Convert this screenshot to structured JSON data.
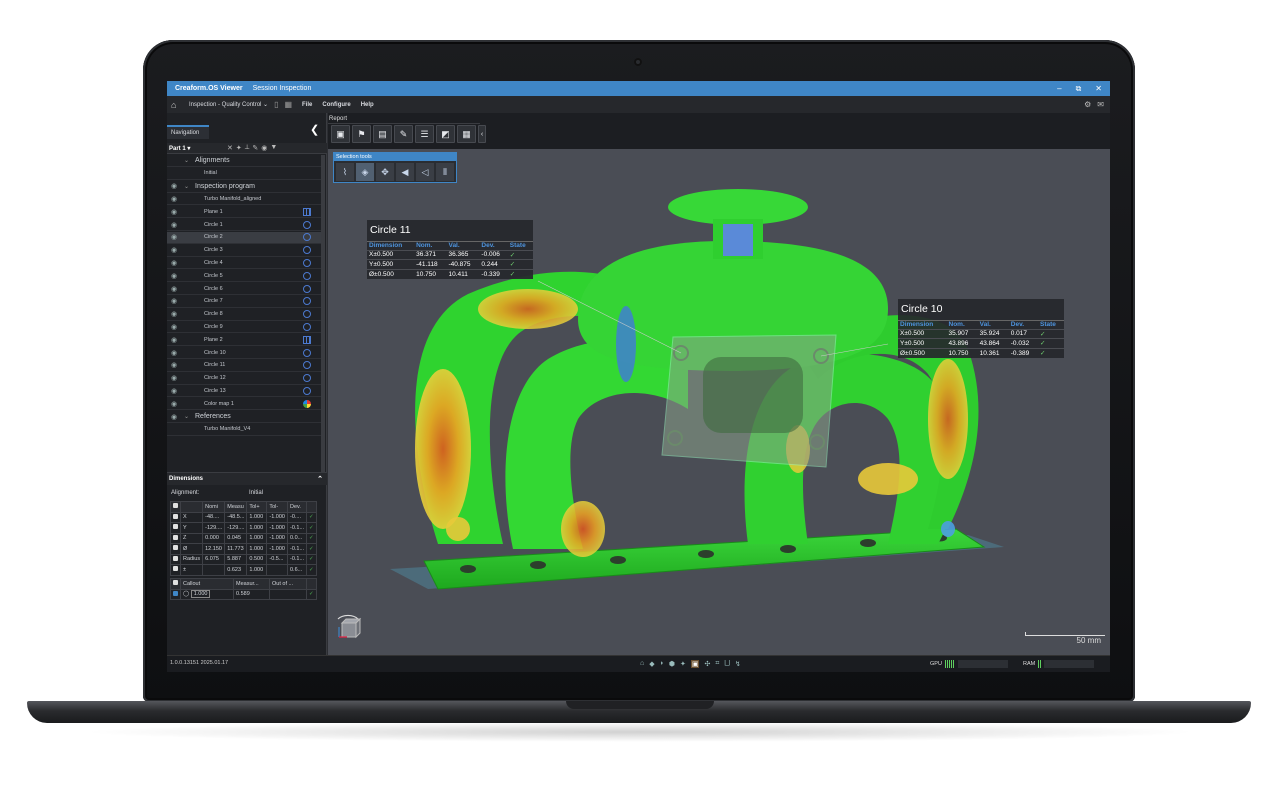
{
  "window": {
    "app_title": "Creaform.OS  Viewer",
    "session_title": "Session Inspection",
    "minimize": "–",
    "maximize": "⧉",
    "close": "✕"
  },
  "menubar": {
    "mode": "Inspection - Quality Control ⌄",
    "items": [
      "File",
      "Configure",
      "Help"
    ]
  },
  "navigation": {
    "tab_label": "Navigation",
    "part_selector": "Part 1",
    "collapse_glyph": "❮",
    "tree": [
      {
        "label": "Alignments",
        "type": "section",
        "eye": false,
        "expanded": true
      },
      {
        "label": "Initial",
        "type": "item",
        "eye": false
      },
      {
        "label": "Inspection program",
        "type": "section",
        "eye": true,
        "expanded": true
      },
      {
        "label": "Turbo Manifold_aligned",
        "type": "item",
        "eye": true
      },
      {
        "label": "Plane 1",
        "type": "item",
        "eye": true,
        "icon": "plane"
      },
      {
        "label": "Circle 1",
        "type": "item",
        "eye": true,
        "icon": "circle"
      },
      {
        "label": "Circle 2",
        "type": "item",
        "eye": true,
        "icon": "circle",
        "selected": true
      },
      {
        "label": "Circle 3",
        "type": "item",
        "eye": true,
        "icon": "circle"
      },
      {
        "label": "Circle 4",
        "type": "item",
        "eye": true,
        "icon": "circle"
      },
      {
        "label": "Circle 5",
        "type": "item",
        "eye": true,
        "icon": "circle"
      },
      {
        "label": "Circle 6",
        "type": "item",
        "eye": true,
        "icon": "circle"
      },
      {
        "label": "Circle 7",
        "type": "item",
        "eye": true,
        "icon": "circle"
      },
      {
        "label": "Circle 8",
        "type": "item",
        "eye": true,
        "icon": "circle"
      },
      {
        "label": "Circle 9",
        "type": "item",
        "eye": true,
        "icon": "circle"
      },
      {
        "label": "Plane 2",
        "type": "item",
        "eye": true,
        "icon": "plane"
      },
      {
        "label": "Circle 10",
        "type": "item",
        "eye": true,
        "icon": "circle"
      },
      {
        "label": "Circle 11",
        "type": "item",
        "eye": true,
        "icon": "circle"
      },
      {
        "label": "Circle 12",
        "type": "item",
        "eye": true,
        "icon": "circle"
      },
      {
        "label": "Circle 13",
        "type": "item",
        "eye": true,
        "icon": "circle"
      },
      {
        "label": "Color map 1",
        "type": "item",
        "eye": true,
        "icon": "colormap"
      },
      {
        "label": "References",
        "type": "section",
        "eye": true,
        "expanded": true
      },
      {
        "label": "Turbo Manifold_V4",
        "type": "item",
        "eye": false
      }
    ]
  },
  "dimensions": {
    "title": "Dimensions",
    "alignment_label": "Alignment:",
    "alignment_value": "Initial",
    "columns": [
      "",
      "",
      "Nomi",
      "Measu",
      "Tol+",
      "Tol-",
      "Dev.",
      ""
    ],
    "rows": [
      {
        "axis": "X",
        "nom": "-48....",
        "meas": "-48.5...",
        "tolp": "1.000",
        "tolm": "-1.000",
        "dev": "-0....",
        "ok": "✓"
      },
      {
        "axis": "Y",
        "nom": "-129....",
        "meas": "-129....",
        "tolp": "1.000",
        "tolm": "-1.000",
        "dev": "-0.1...",
        "ok": "✓"
      },
      {
        "axis": "Z",
        "nom": "0.000",
        "meas": "0.045",
        "tolp": "1.000",
        "tolm": "-1.000",
        "dev": "0.0...",
        "ok": "✓"
      },
      {
        "axis": "Ø",
        "nom": "12.150",
        "meas": "11.773",
        "tolp": "1.000",
        "tolm": "-1.000",
        "dev": "-0.1...",
        "ok": "✓"
      },
      {
        "axis": "Radius",
        "nom": "6.075",
        "meas": "5.887",
        "tolp": "0.500",
        "tolm": "-0.5...",
        "dev": "-0.1...",
        "ok": "✓"
      },
      {
        "axis": "±",
        "nom": "",
        "meas": "0.623",
        "tolp": "1.000",
        "tolm": "",
        "dev": "0.6...",
        "ok": "✓"
      }
    ],
    "callout_columns": [
      "Callout",
      "Measur...",
      "Out of ..."
    ],
    "callout_row": {
      "tol": "1.000",
      "meas": "0.589",
      "ok": "✓"
    }
  },
  "report": {
    "label": "Report",
    "tools": [
      "report-snapshot",
      "report-flag",
      "report-capture",
      "report-edit",
      "report-page",
      "report-chart",
      "report-table"
    ]
  },
  "selection_tools": {
    "label": "Selection tools",
    "tools": [
      "lasso",
      "surface",
      "freeform",
      "select-a",
      "select-b",
      "mirror"
    ]
  },
  "callouts": [
    {
      "title": "Circle 11",
      "headers": [
        "Dimension",
        "Nom.",
        "Val.",
        "Dev.",
        "State"
      ],
      "rows": [
        [
          "X±0.500",
          "36.371",
          "36.365",
          "-0.006",
          "✓"
        ],
        [
          "Y±0.500",
          "-41.118",
          "-40.875",
          "0.244",
          "✓"
        ],
        [
          "Ø±0.500",
          "10.750",
          "10.411",
          "-0.339",
          "✓"
        ]
      ]
    },
    {
      "title": "Circle 10",
      "headers": [
        "Dimension",
        "Nom.",
        "Val.",
        "Dev.",
        "State"
      ],
      "rows": [
        [
          "X±0.500",
          "35.907",
          "35.924",
          "0.017",
          "✓"
        ],
        [
          "Y±0.500",
          "43.896",
          "43.864",
          "-0.032",
          "✓"
        ],
        [
          "Ø±0.500",
          "10.750",
          "10.361",
          "-0.389",
          "✓"
        ]
      ]
    }
  ],
  "scale": "50 mm",
  "status": {
    "version": "1.0.0.13151 2025.01.17",
    "gpu_label": "GPU",
    "ram_label": "RAM"
  },
  "colors": {
    "accent": "#3f86c6",
    "ok": "#6fcf6f",
    "deviation_green": "#2ecc2e",
    "deviation_yellow": "#e8c93a",
    "deviation_orange": "#e77c1e",
    "deviation_blue": "#3f7fd0"
  }
}
